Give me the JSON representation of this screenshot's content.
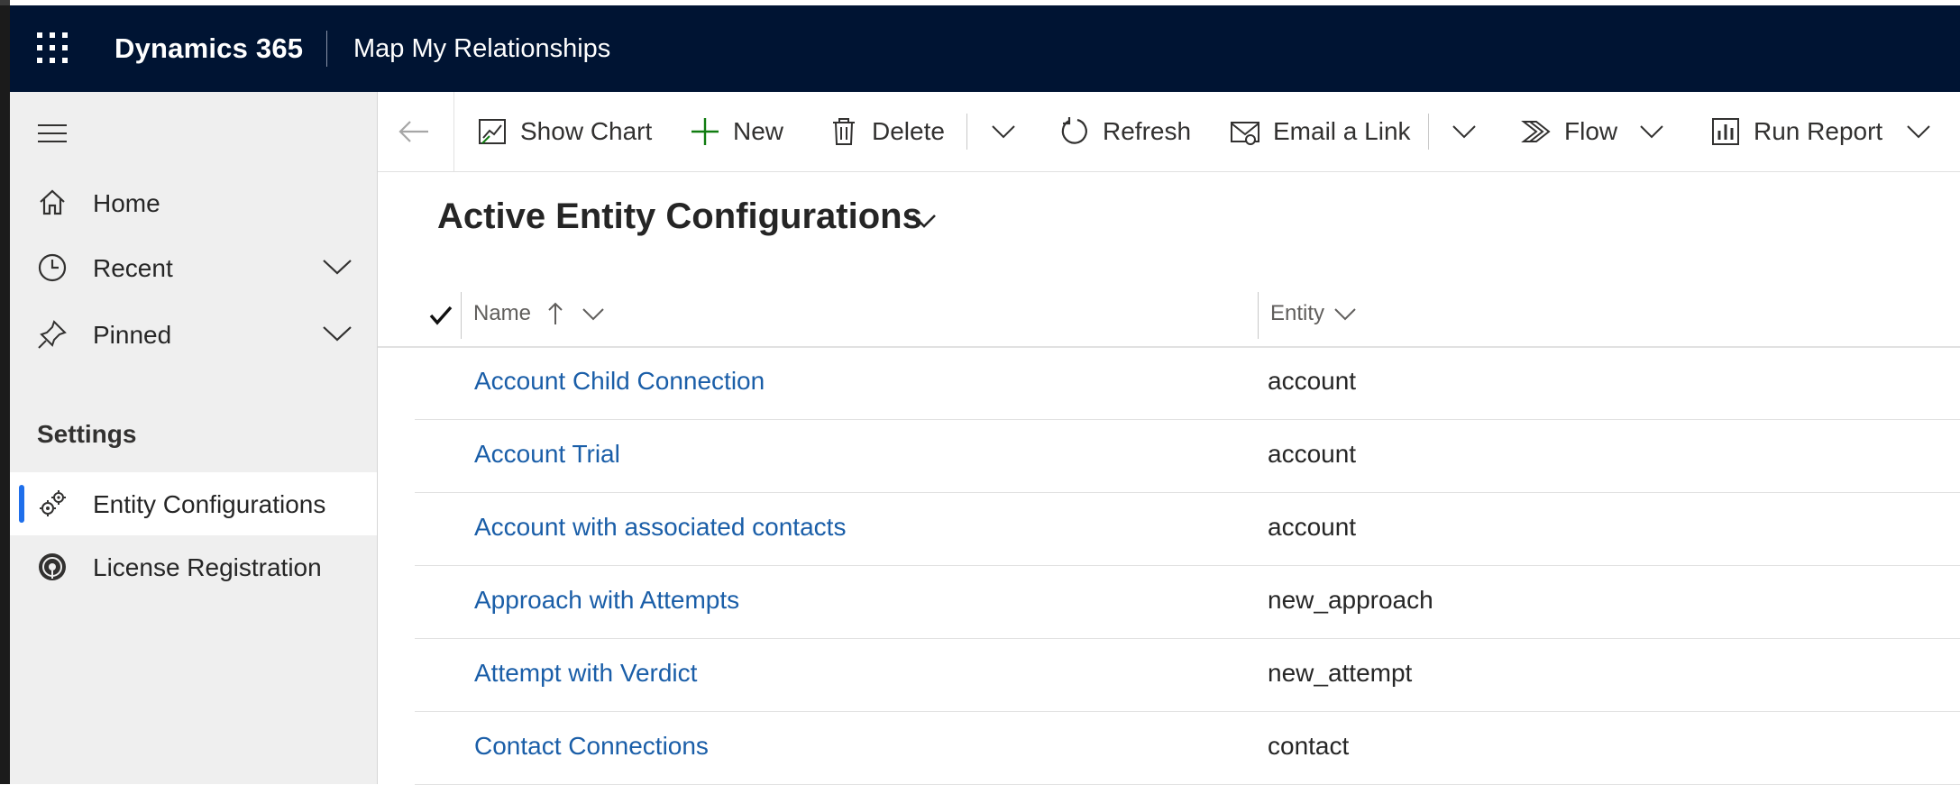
{
  "header": {
    "brand": "Dynamics 365",
    "app_name": "Map My Relationships"
  },
  "sidebar": {
    "items": [
      {
        "label": "Home",
        "icon": "home-icon"
      },
      {
        "label": "Recent",
        "icon": "clock-icon"
      },
      {
        "label": "Pinned",
        "icon": "pin-icon"
      }
    ],
    "section_title": "Settings",
    "settings_items": [
      {
        "label": "Entity Configurations",
        "icon": "gears-icon",
        "selected": true
      },
      {
        "label": "License Registration",
        "icon": "license-icon",
        "selected": false
      }
    ]
  },
  "commands": {
    "show_chart": "Show Chart",
    "new": "New",
    "delete": "Delete",
    "refresh": "Refresh",
    "email_link": "Email a Link",
    "flow": "Flow",
    "run_report": "Run Report"
  },
  "view": {
    "title": "Active Entity Configurations"
  },
  "grid": {
    "columns": [
      "Name",
      "Entity"
    ],
    "rows": [
      {
        "name": "Account Child Connection",
        "entity": "account"
      },
      {
        "name": "Account Trial",
        "entity": "account"
      },
      {
        "name": "Account with associated contacts",
        "entity": "account"
      },
      {
        "name": "Approach with Attempts",
        "entity": "new_approach"
      },
      {
        "name": "Attempt with Verdict",
        "entity": "new_attempt"
      },
      {
        "name": "Contact Connections",
        "entity": "contact"
      }
    ]
  },
  "colors": {
    "topbar": "#001433",
    "link": "#1a5ea8",
    "selection_accent": "#1f6feb",
    "new_icon": "#107c10"
  }
}
